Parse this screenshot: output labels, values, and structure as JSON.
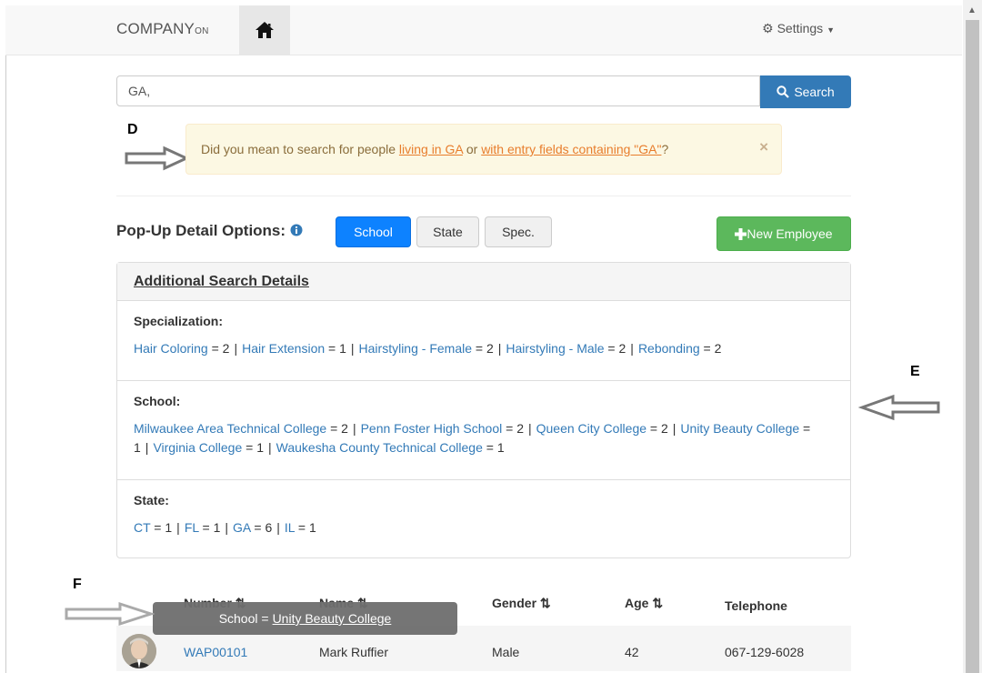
{
  "navbar": {
    "brand": "COMPANY",
    "brand_suffix": "ON",
    "settings_label": "Settings"
  },
  "search": {
    "value": "GA,",
    "button_label": "Search"
  },
  "alert": {
    "prefix": "Did you mean to search for people ",
    "link1": "living in GA",
    "middle": " or ",
    "link2": "with entry fields containing \"GA\"",
    "suffix": "?",
    "close": "×"
  },
  "annotations": {
    "d": "D",
    "e": "E",
    "f": "F"
  },
  "options": {
    "label": "Pop-Up Detail Options:",
    "school": "School",
    "state": "State",
    "spec": "Spec.",
    "new_employee": "New Employee"
  },
  "details": {
    "title": "Additional Search Details",
    "specialization": {
      "heading": "Specialization:",
      "items": [
        {
          "name": "Hair Coloring",
          "count": " = 2"
        },
        {
          "name": "Hair Extension",
          "count": " = 1"
        },
        {
          "name": "Hairstyling - Female",
          "count": " = 2"
        },
        {
          "name": "Hairstyling - Male",
          "count": " = 2"
        },
        {
          "name": "Rebonding",
          "count": " = 2"
        }
      ]
    },
    "school": {
      "heading": "School:",
      "items": [
        {
          "name": "Milwaukee Area Technical College",
          "count": " = 2"
        },
        {
          "name": "Penn Foster High School",
          "count": " = 2"
        },
        {
          "name": "Queen City College",
          "count": " = 2"
        },
        {
          "name": "Unity Beauty College",
          "count": " = 1"
        },
        {
          "name": "Virginia College",
          "count": " = 1"
        },
        {
          "name": "Waukesha County Technical College",
          "count": " = 1"
        }
      ]
    },
    "state": {
      "heading": "State:",
      "items": [
        {
          "name": "CT",
          "count": " = 1"
        },
        {
          "name": "FL",
          "count": " = 1"
        },
        {
          "name": "GA",
          "count": " = 6"
        },
        {
          "name": "IL",
          "count": " = 1"
        }
      ]
    }
  },
  "table": {
    "headers": {
      "number": "Number",
      "name": "Name",
      "gender": "Gender",
      "age": "Age",
      "telephone": "Telephone"
    },
    "rows": [
      {
        "number": "WAP00101",
        "name": "Mark Ruffier",
        "gender": "Male",
        "age": "42",
        "telephone": "067-129-6028"
      }
    ]
  },
  "tooltip": {
    "prefix": "School = ",
    "value": "Unity Beauty College"
  }
}
